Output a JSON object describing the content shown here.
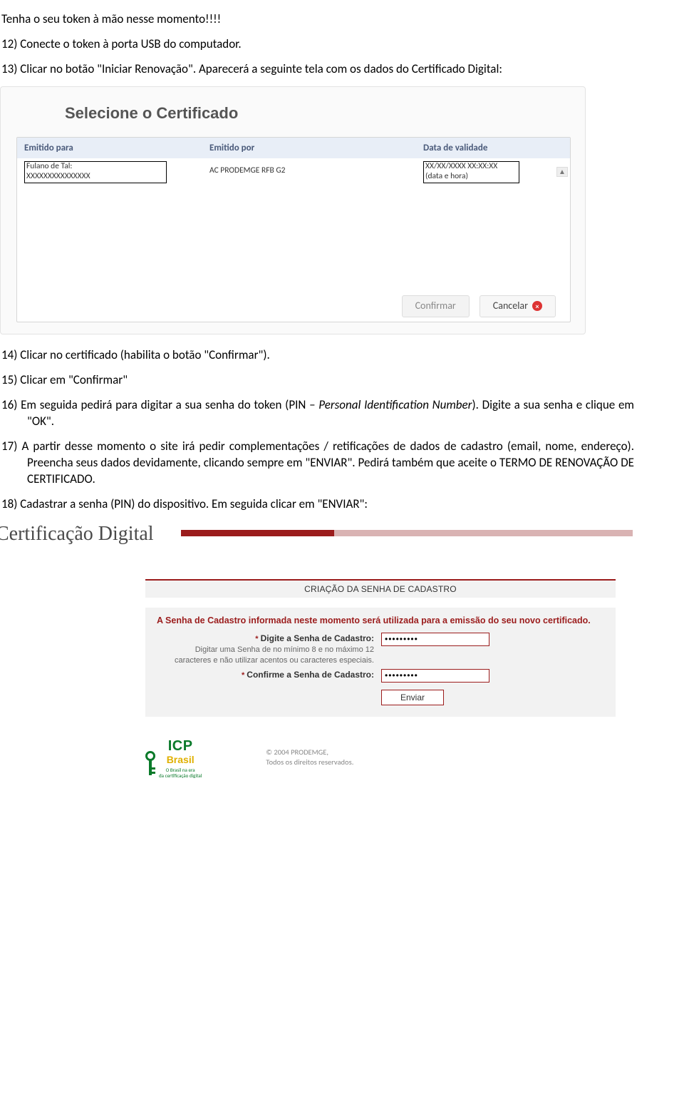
{
  "doc": {
    "heading": "Tenha o seu token à mão nesse momento!!!!",
    "p12": "12) Conecte o token à porta USB do computador.",
    "p13a": "13) Clicar no botão \"Iniciar Renovação\". Aparecerá a seguinte tela com os dados do Certificado Digital:",
    "p14": "14) Clicar no certificado (habilita o botão \"Confirmar\").",
    "p15": "15) Clicar em \"Confirmar\"",
    "p16": "16) Em seguida pedirá para digitar a sua senha do token (PIN – Personal Identification Number). Digite a sua senha e clique em \"OK\".",
    "p17": "17) A partir desse momento o site irá pedir complementações / retificações de dados de cadastro (email, nome, endereço). Preencha seus dados devidamente, clicando sempre em \"ENVIAR\". Pedirá também que aceite o TERMO DE RENOVAÇÃO DE CERTIFICADO.",
    "p18": "18) Cadastrar a senha (PIN) do dispositivo. Em seguida clicar em \"ENVIAR\":"
  },
  "cert": {
    "title": "Selecione o Certificado",
    "cols": {
      "c1": "Emitido para",
      "c2": "Emitido por",
      "c3": "Data de validade"
    },
    "row": {
      "para_l1": "Fulano de Tal:",
      "para_l2": "XXXXXXXXXXXXXXX",
      "por": "AC PRODEMGE RFB G2",
      "data_l1": "XX/XX/XXXX XX:XX:XX",
      "data_l2": "(data e hora)"
    },
    "confirm": "Confirmar",
    "cancel": "Cancelar"
  },
  "certdig": {
    "brand": "Certificação Digital",
    "form_header": "CRIAÇÃO DA SENHA DE CADASTRO",
    "warn": "A Senha de Cadastro informada neste momento será utilizada para a emissão do seu novo certificado.",
    "field1_label": "* Digite a Senha de Cadastro:",
    "field1_hint": "Digitar uma Senha de no mínimo 8 e no máximo 12 caracteres e não utilizar acentos ou caracteres especiais.",
    "field2_label": "* Confirme a Senha de Cadastro:",
    "pw_mask": "•••••••••",
    "send": "Enviar",
    "icp_top": "ICP",
    "icp_bot": "Brasil",
    "icp_tag1": "O Brasil na era",
    "icp_tag2": "da certificação digital",
    "copy1": "© 2004 PRODEMGE,",
    "copy2": "Todos os direitos reservados."
  }
}
